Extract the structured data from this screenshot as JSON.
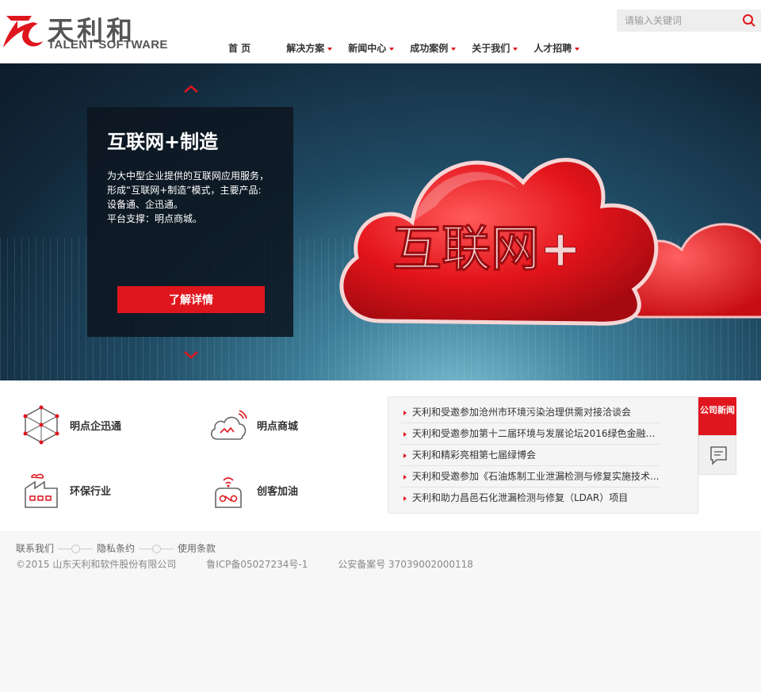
{
  "brand": {
    "name_cn": "天利和",
    "name_en": "TALENT SOFTWARE",
    "accent": "#e0161e"
  },
  "search": {
    "placeholder": "请输入关键词"
  },
  "nav": {
    "items": [
      {
        "label": "首 页"
      },
      {
        "label": "解决方案"
      },
      {
        "label": "新闻中心"
      },
      {
        "label": "成功案例"
      },
      {
        "label": "关于我们"
      },
      {
        "label": "人才招聘"
      }
    ]
  },
  "banner": {
    "title": "互联网+制造",
    "desc": [
      "为大中型企业提供的互联网应用服务，",
      "形成“互联网+制造”模式，主要产品:",
      "设备通、企迅通。",
      "平台支撑：明点商城。"
    ],
    "button_label": "了解详情",
    "cloud_text": "互联网+"
  },
  "features": [
    {
      "label": "明点企迅通",
      "icon": "network-cube-icon"
    },
    {
      "label": "明点商城",
      "icon": "cloud-signal-icon"
    },
    {
      "label": "环保行业",
      "icon": "factory-icon"
    },
    {
      "label": "创客加油",
      "icon": "fuel-device-icon"
    }
  ],
  "news": {
    "tab_label": "公司新闻",
    "items": [
      "天利和受邀参加沧州市环境污染治理供需对接洽谈会",
      "天利和受邀参加第十二届环境与发展论坛2016绿色金融暨...",
      "天利和精彩亮相第七届绿博会",
      "天利和受邀参加《石油炼制工业泄漏检测与修复实施技术...",
      "天利和助力昌邑石化泄漏检测与修复（LDAR）项目"
    ]
  },
  "footer": {
    "links": [
      "联系我们",
      "隐私条约",
      "使用条款"
    ],
    "copyright": "©2015 山东天利和软件股份有限公司",
    "icp": "鲁ICP备05027234号-1",
    "police": "公安备案号 37039002000118"
  }
}
